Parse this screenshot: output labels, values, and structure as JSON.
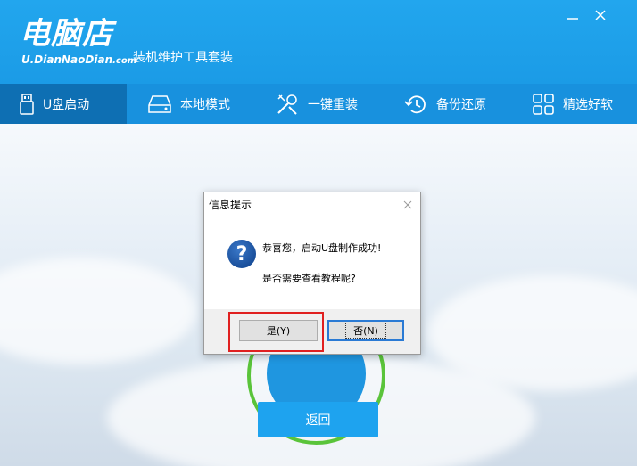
{
  "header": {
    "logo_title": "电脑店",
    "logo_url": "U.DianNaoDian",
    "logo_url_suffix": ".com",
    "tagline": "装机维护工具套装"
  },
  "nav": {
    "items": [
      {
        "label": "U盘启动",
        "icon": "usb-icon",
        "active": true
      },
      {
        "label": "本地模式",
        "icon": "drive-icon",
        "active": false
      },
      {
        "label": "一键重装",
        "icon": "tools-icon",
        "active": false
      },
      {
        "label": "备份还原",
        "icon": "restore-icon",
        "active": false
      },
      {
        "label": "精选好软",
        "icon": "grid-icon",
        "active": false
      }
    ]
  },
  "main": {
    "back_label": "返回"
  },
  "dialog": {
    "title": "信息提示",
    "message1": "恭喜您，启动U盘制作成功!",
    "message2": "是否需要查看教程呢?",
    "yes_label": "是(Y)",
    "no_label": "否(N)"
  },
  "colors": {
    "header": "#1b9be6",
    "nav": "#1891de",
    "nav_active": "#0e6fb3",
    "accent_button": "#1ea3ef",
    "ring": "#5ac43a",
    "highlight": "#e02020"
  }
}
